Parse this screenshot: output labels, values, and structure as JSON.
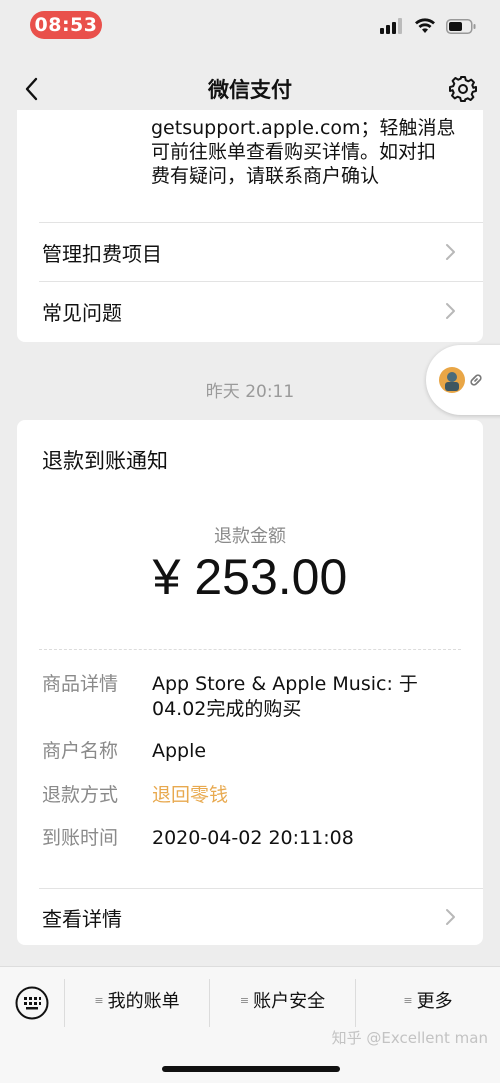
{
  "status_bar": {
    "time": "08:53",
    "signal_icon": "signal-icon",
    "wifi_icon": "wifi-icon",
    "battery_icon": "battery-icon"
  },
  "nav": {
    "title": "微信支付",
    "back_icon": "back-chevron-icon",
    "settings_icon": "gear-icon"
  },
  "top_card": {
    "message_lines": [
      "getsupport.apple.com；轻触消息",
      "可前往账单查看购买详情。如对扣",
      "费有疑问，请联系商户确认"
    ],
    "links": [
      {
        "label": "管理扣费项目"
      },
      {
        "label": "常见问题"
      }
    ]
  },
  "timestamp": "昨天 20:11",
  "refund_card": {
    "title": "退款到账通知",
    "amount_label": "退款金额",
    "amount": "¥ 253.00",
    "details": [
      {
        "key": "商品详情",
        "value_lines": [
          "App Store & Apple Music: 于",
          "04.02完成的购买"
        ]
      },
      {
        "key": "商户名称",
        "value_lines": [
          "Apple"
        ]
      },
      {
        "key": "退款方式",
        "value_lines": [
          "退回零钱"
        ]
      },
      {
        "key": "到账时间",
        "value_lines": [
          "2020-04-02 20:11:08"
        ]
      }
    ],
    "view_details": "查看详情"
  },
  "bottom_tabs": [
    {
      "label": "我的账单"
    },
    {
      "label": "账户安全"
    },
    {
      "label": "更多"
    }
  ],
  "watermark": "知乎 @Excellent man",
  "colors": {
    "accent_orange": "#e8a94f",
    "time_pill": "#e9504b",
    "background": "#ededed"
  }
}
